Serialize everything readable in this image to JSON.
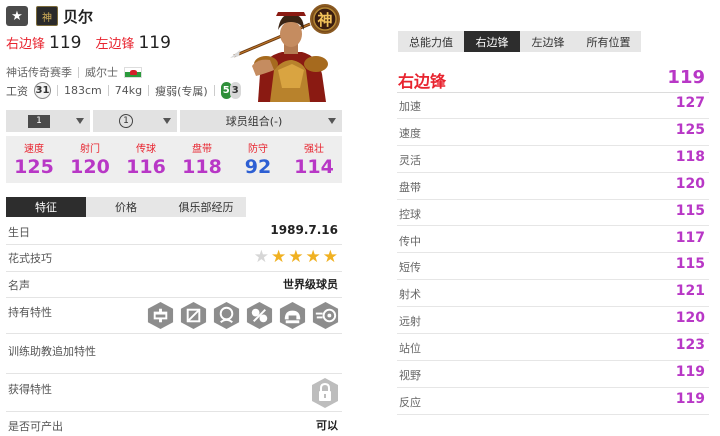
{
  "header": {
    "favorite_icon": "star-icon",
    "season_badge_icon": "season-badge-icon",
    "name": "贝尔",
    "positions": [
      {
        "label": "右边锋",
        "value": "119"
      },
      {
        "label": "左边锋",
        "value": "119"
      }
    ],
    "season": "神话传奇赛季",
    "nationality": "威尔士",
    "wage_label": "工资",
    "wage": "31",
    "height": "183cm",
    "weight": "74kg",
    "body_type": "瘦弱(专属)",
    "left_foot": "5",
    "right_foot": "3",
    "emblem_text": "神"
  },
  "selectors": {
    "level": "1",
    "enhance": "1",
    "team_chem": "球员组合(-)"
  },
  "stats": [
    {
      "label": "速度",
      "value": "125",
      "color": "#b837c6"
    },
    {
      "label": "射门",
      "value": "120",
      "color": "#b837c6"
    },
    {
      "label": "传球",
      "value": "116",
      "color": "#b837c6"
    },
    {
      "label": "盘带",
      "value": "118",
      "color": "#b837c6"
    },
    {
      "label": "防守",
      "value": "92",
      "color": "#2d5fd3"
    },
    {
      "label": "强壮",
      "value": "114",
      "color": "#b837c6"
    }
  ],
  "left_tabs": [
    "特征",
    "价格",
    "俱乐部经历"
  ],
  "info": {
    "birthday_label": "生日",
    "birthday": "1989.7.16",
    "skill_label": "花式技巧",
    "skill_stars": 4,
    "skill_max": 5,
    "fame_label": "名声",
    "fame": "世界级球员",
    "traits_label": "持有特性",
    "trait_icons": [
      "trait-injury-prone-icon",
      "trait-finesse-shot-icon",
      "trait-speed-dribbler-icon",
      "trait-flair-icon",
      "trait-power-header-icon",
      "trait-early-crosser-icon"
    ],
    "coach_traits_label": "训练助教追加特性",
    "obtained_traits_label": "获得特性",
    "producible_label": "是否可产出",
    "producible": "可以"
  },
  "right_tabs": [
    "总能力值",
    "右边锋",
    "左边锋",
    "所有位置"
  ],
  "right_panel": {
    "position": "右边锋",
    "overall": "119",
    "attributes": [
      {
        "label": "加速",
        "value": "127"
      },
      {
        "label": "速度",
        "value": "125"
      },
      {
        "label": "灵活",
        "value": "118"
      },
      {
        "label": "盘带",
        "value": "120"
      },
      {
        "label": "控球",
        "value": "115"
      },
      {
        "label": "传中",
        "value": "117"
      },
      {
        "label": "短传",
        "value": "115"
      },
      {
        "label": "射术",
        "value": "121"
      },
      {
        "label": "远射",
        "value": "120"
      },
      {
        "label": "站位",
        "value": "123"
      },
      {
        "label": "视野",
        "value": "119"
      },
      {
        "label": "反应",
        "value": "119"
      }
    ]
  },
  "colors": {
    "accent_red": "#e8242f",
    "purple_value": "#b837c6",
    "blue_value": "#2d5fd3",
    "star_gold": "#f0b122"
  }
}
